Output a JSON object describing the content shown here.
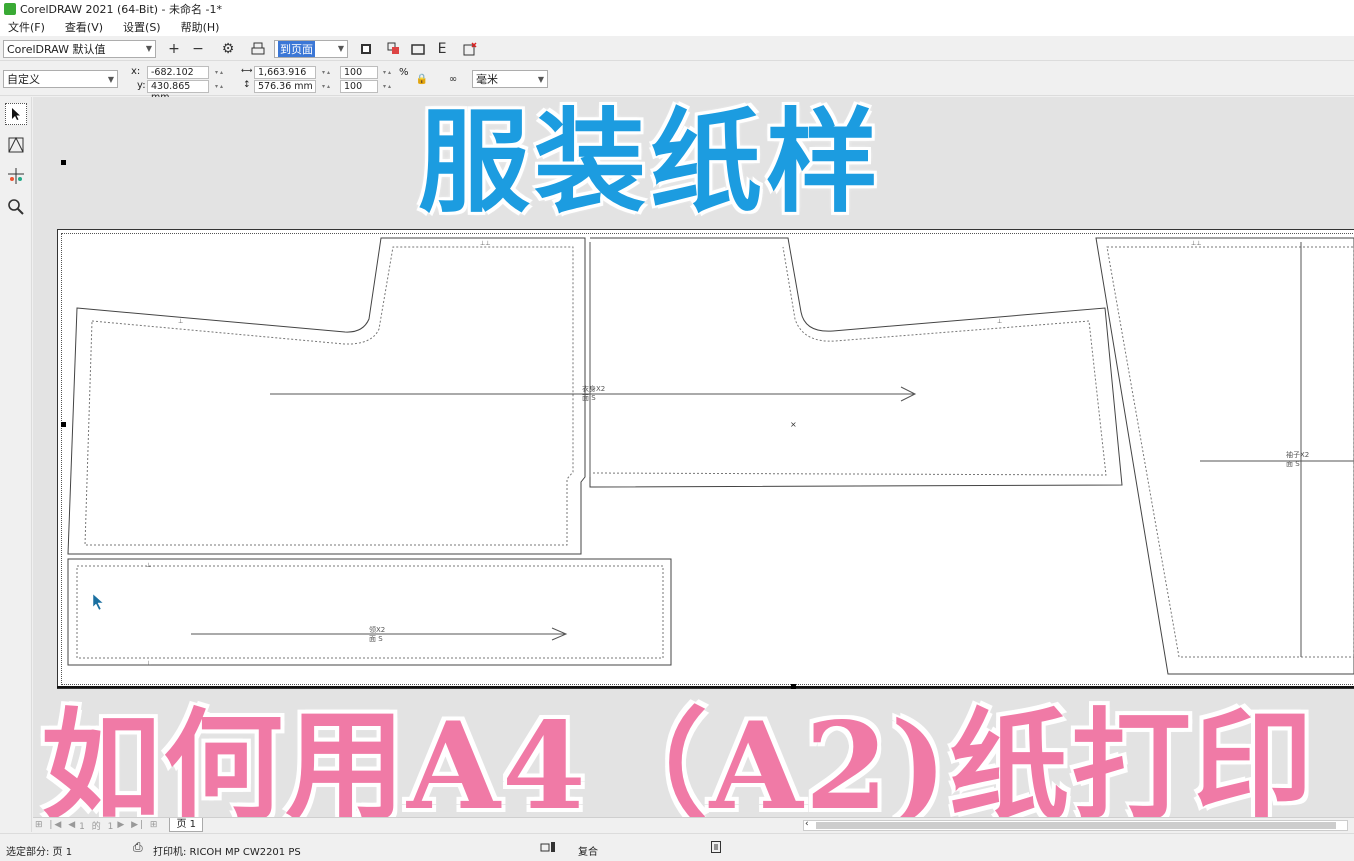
{
  "window": {
    "title": "CorelDRAW 2021 (64-Bit) - 未命名 -1*"
  },
  "menu": [
    "文件(F)",
    "查看(V)",
    "设置(S)",
    "帮助(H)"
  ],
  "toolbar": {
    "preset": "CorelDRAW 默认值",
    "zoom": "到页面",
    "icon_e_label": "E"
  },
  "propbar": {
    "page_size": "自定义",
    "x_label": "x:",
    "y_label": "y:",
    "x_value": "-682.102 mm",
    "y_value": "430.865 mm",
    "w_value": "1,663.916 mm",
    "h_value": "576.36 mm",
    "scale_x": "100",
    "scale_y": "100",
    "percent": "%",
    "units": "毫米"
  },
  "drawing": {
    "piece1_label": "衣身X2",
    "piece1_size": "面   S",
    "piece2_label": "领X2",
    "piece2_size": "面   S",
    "piece3_label": "袖子X2",
    "piece3_size": "面   S"
  },
  "overlay": {
    "top_title": "服装纸样",
    "bottom_title": "如何用A4（A2)纸打印"
  },
  "pagebar": {
    "page_count": "1 的 1",
    "page_tab": "页 1"
  },
  "status": {
    "selection": "选定部分:  页 1",
    "printer": "打印机:  RICOH MP CW2201 PS",
    "mode": "复合"
  },
  "colors": {
    "accent_blue": "#1c9ce0",
    "accent_pink": "#f07aa6",
    "selection": "#3b77d6"
  }
}
